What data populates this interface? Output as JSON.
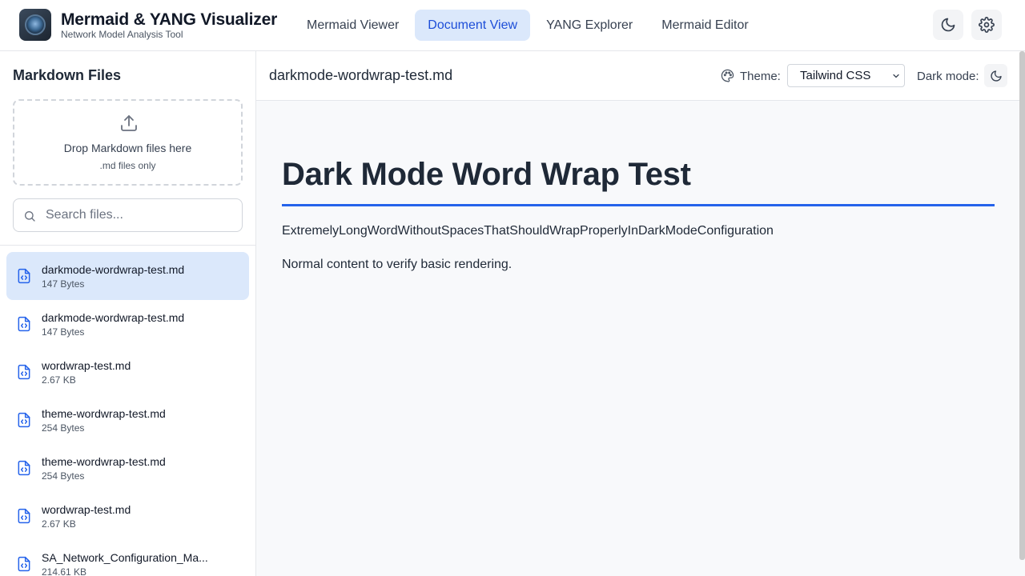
{
  "app": {
    "title": "Mermaid & YANG Visualizer",
    "subtitle": "Network Model Analysis Tool"
  },
  "nav": {
    "tabs": [
      {
        "label": "Mermaid Viewer",
        "active": false
      },
      {
        "label": "Document View",
        "active": true
      },
      {
        "label": "YANG Explorer",
        "active": false
      },
      {
        "label": "Mermaid Editor",
        "active": false
      }
    ]
  },
  "header_icons": [
    "moon-icon",
    "gear-icon"
  ],
  "sidebar": {
    "title": "Markdown Files",
    "dropzone": {
      "main": "Drop Markdown files here",
      "sub": ".md files only"
    },
    "search": {
      "placeholder": "Search files...",
      "value": ""
    },
    "files": [
      {
        "name": "darkmode-wordwrap-test.md",
        "size": "147 Bytes",
        "active": true
      },
      {
        "name": "darkmode-wordwrap-test.md",
        "size": "147 Bytes",
        "active": false
      },
      {
        "name": "wordwrap-test.md",
        "size": "2.67 KB",
        "active": false
      },
      {
        "name": "theme-wordwrap-test.md",
        "size": "254 Bytes",
        "active": false
      },
      {
        "name": "theme-wordwrap-test.md",
        "size": "254 Bytes",
        "active": false
      },
      {
        "name": "wordwrap-test.md",
        "size": "2.67 KB",
        "active": false
      },
      {
        "name": "SA_Network_Configuration_Ma...",
        "size": "214.61 KB",
        "active": false
      }
    ]
  },
  "document": {
    "filename": "darkmode-wordwrap-test.md",
    "theme_label": "Theme:",
    "theme_value": "Tailwind CSS",
    "darkmode_label": "Dark mode:",
    "heading": "Dark Mode Word Wrap Test",
    "paragraphs": [
      "ExtremelyLongWordWithoutSpacesThatShouldWrapProperlyInDarkModeConfiguration",
      "Normal content to verify basic rendering."
    ]
  },
  "colors": {
    "accent": "#1d4ed8",
    "active_bg": "#dbe8fb",
    "heading_rule": "#2563eb"
  }
}
